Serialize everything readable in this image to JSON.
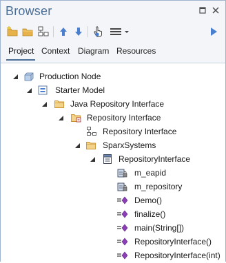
{
  "window": {
    "title": "Browser"
  },
  "tabs": [
    {
      "label": "Project",
      "active": true
    },
    {
      "label": "Context",
      "active": false
    },
    {
      "label": "Diagram",
      "active": false
    },
    {
      "label": "Resources",
      "active": false
    }
  ],
  "tree": {
    "nodes": [
      {
        "label": "Production Node",
        "icon": "node-icon"
      },
      {
        "label": "Starter Model",
        "icon": "model-icon"
      },
      {
        "label": "Java Repository Interface",
        "icon": "package-icon"
      },
      {
        "label": "Repository Interface",
        "icon": "package-diagram-icon"
      },
      {
        "label": "Repository Interface",
        "icon": "diagram-icon"
      },
      {
        "label": "SparxSystems",
        "icon": "package-icon"
      },
      {
        "label": "RepositoryInterface",
        "icon": "class-icon"
      },
      {
        "label": "m_eapid",
        "icon": "attribute-icon"
      },
      {
        "label": "m_repository",
        "icon": "attribute-icon"
      },
      {
        "label": "Demo()",
        "icon": "operation-icon"
      },
      {
        "label": "finalize()",
        "icon": "operation-icon"
      },
      {
        "label": "main(String[])",
        "icon": "operation-icon"
      },
      {
        "label": "RepositoryInterface()",
        "icon": "operation-icon"
      },
      {
        "label": "RepositoryInterface(int)",
        "icon": "operation-icon"
      }
    ]
  },
  "colors": {
    "title": "#4a6e96",
    "chrome_bg": "#f3f5f8",
    "border": "#9fb3cf",
    "accent_blue": "#4a7fd0",
    "folder": "#e8b24a",
    "operation": "#8a3fb5"
  }
}
